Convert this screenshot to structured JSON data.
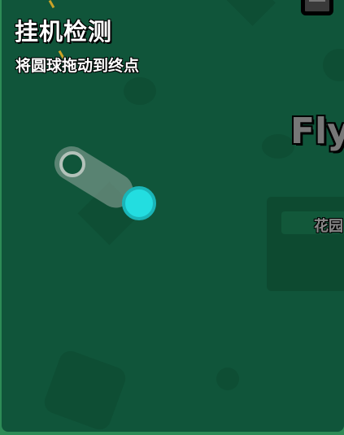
{
  "captcha": {
    "title": "挂机检测",
    "instruction": "将圆球拖动到终点"
  },
  "background": {
    "title_fragment": "Fly",
    "card_label_fragment": "花园"
  },
  "colors": {
    "panel_bg": "#10553a",
    "ball": "#23dde0",
    "track": "#96aaa0"
  }
}
